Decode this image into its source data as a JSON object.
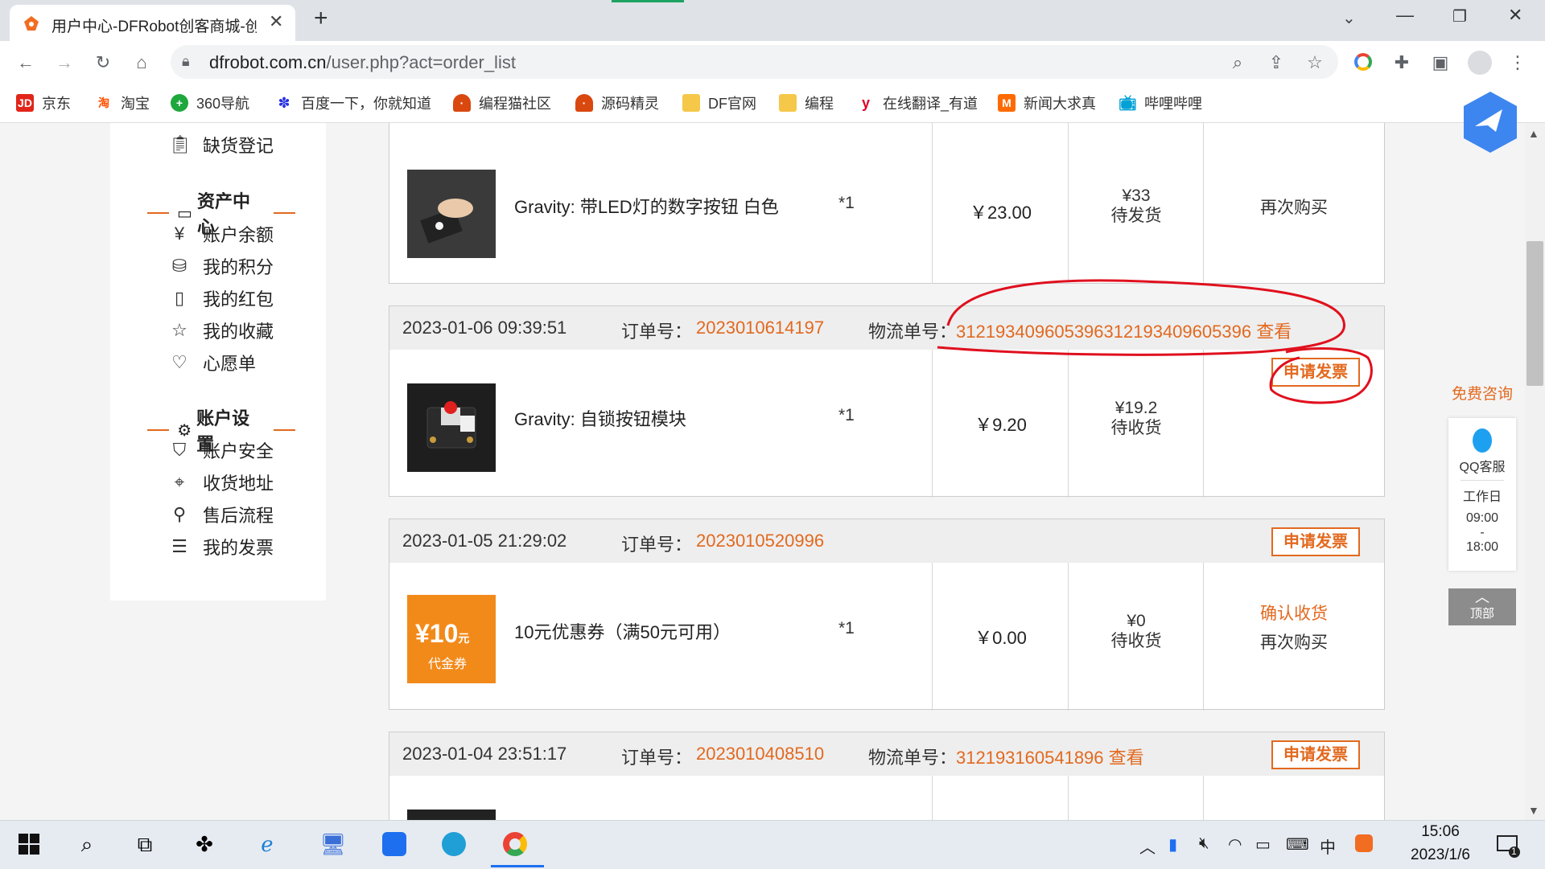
{
  "browser": {
    "tab_title": "用户中心-DFRobot创客商城-创客",
    "new_tab": "+",
    "url_host": "dfrobot.com.cn",
    "url_path": "/user.php?act=order_list",
    "bookmarks": [
      {
        "label": "京东",
        "icon": "jd-icon",
        "color": "#e1251b"
      },
      {
        "label": "淘宝",
        "icon": "taobao-icon",
        "color": "#ff5000"
      },
      {
        "label": "360导航",
        "icon": "360-icon",
        "color": "#1ea73c"
      },
      {
        "label": "百度一下，你就知道",
        "icon": "baidu-icon",
        "color": "#2932e1"
      },
      {
        "label": "编程猫社区",
        "icon": "codemao-icon",
        "color": "#d9480f"
      },
      {
        "label": "源码精灵",
        "icon": "codemao-icon",
        "color": "#d9480f"
      },
      {
        "label": "DF官网",
        "icon": "folder-icon",
        "color": "#f5c84a"
      },
      {
        "label": "编程",
        "icon": "folder-icon",
        "color": "#f5c84a"
      },
      {
        "label": "在线翻译_有道",
        "icon": "youdao-icon",
        "color": "#e0002b"
      },
      {
        "label": "新闻大求真",
        "icon": "news-icon",
        "color": "#ff6a00"
      },
      {
        "label": "哔哩哔哩",
        "icon": "bilibili-icon",
        "color": "#00a1d6"
      }
    ]
  },
  "sidebar": {
    "top_item": "缺货登记",
    "sections": [
      {
        "title": "资产中心",
        "items": [
          "账户余额",
          "我的积分",
          "我的红包",
          "我的收藏",
          "心愿单"
        ]
      },
      {
        "title": "账户设置",
        "items": [
          "账户安全",
          "收货地址",
          "售后流程",
          "我的发票"
        ]
      }
    ]
  },
  "labels": {
    "order_no": "订单号：",
    "ship_no": "物流单号：",
    "view": "查看",
    "invoice": "申请发票"
  },
  "orders": [
    {
      "product": "Gravity: 带LED灯的数字按钮 白色",
      "qty": "*1",
      "price": "￥23.00",
      "total": "¥33",
      "status": "待发货",
      "actions": [
        "再次购买"
      ]
    },
    {
      "date": "2023-01-06 09:39:51",
      "order_no": "2023010614197",
      "ship_no": "312193409605396312193409605396",
      "product": "Gravity: 自锁按钮模块",
      "qty": "*1",
      "price": "￥9.20",
      "total": "¥19.2",
      "status": "待收货",
      "actions": []
    },
    {
      "date": "2023-01-05 21:29:02",
      "order_no": "2023010520996",
      "product": "10元优惠券（满50元可用）",
      "coupon_value": "¥10",
      "coupon_unit": "元",
      "coupon_caption": "代金券",
      "qty": "*1",
      "price": "￥0.00",
      "total": "¥0",
      "status": "待收货",
      "actions": [
        "确认收货",
        "再次购买"
      ]
    },
    {
      "date": "2023-01-04 23:51:17",
      "order_no": "2023010408510",
      "ship_no": "312193160541896"
    }
  ],
  "float_panel": {
    "consult": "免费咨询",
    "qq": "QQ客服",
    "workday": "工作日",
    "open": "09:00",
    "dash": "-",
    "close": "18:00",
    "top": "顶部"
  },
  "taskbar": {
    "time": "15:06",
    "date": "2023/1/6",
    "ime": "中",
    "notifications": "1"
  },
  "colors": {
    "accent": "#e2691f",
    "annotation": "#e0101e"
  }
}
